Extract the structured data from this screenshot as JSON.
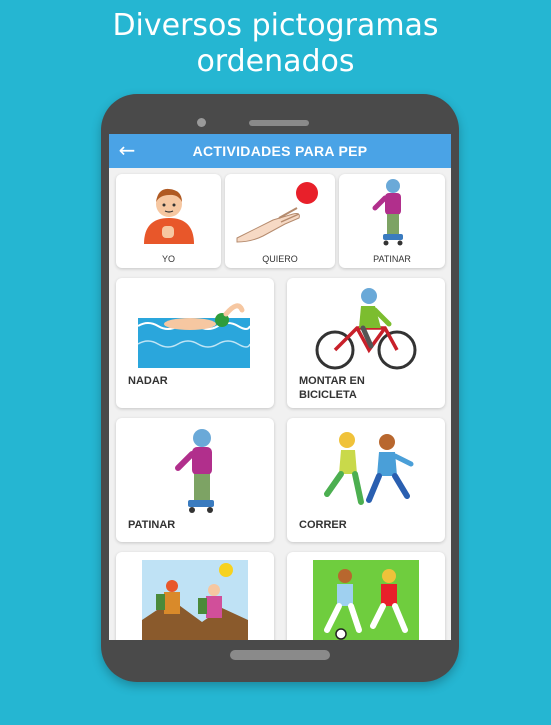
{
  "headline": {
    "line1": "Diversos pictogramas",
    "line2": "ordenados"
  },
  "appbar": {
    "title": "ACTIVIDADES PARA PEP",
    "back_icon": "arrow-left-icon"
  },
  "grid_small": [
    {
      "label": "YO",
      "icon": "boy-pointing-self-pictogram"
    },
    {
      "label": "QUIERO",
      "icon": "hand-reaching-ball-pictogram"
    },
    {
      "label": "PATINAR",
      "icon": "inline-skater-pictogram"
    }
  ],
  "grid_large": [
    {
      "label": "NADAR",
      "icon": "swimmer-pictogram"
    },
    {
      "label": "MONTAR EN BICICLETA",
      "label_line1": "MONTAR EN",
      "label_line2": "BICICLETA",
      "icon": "cyclist-pictogram"
    },
    {
      "label": "PATINAR",
      "icon": "inline-skater-pictogram"
    },
    {
      "label": "CORRER",
      "icon": "runners-pictogram"
    },
    {
      "label": "",
      "icon": "hikers-pictogram"
    },
    {
      "label": "",
      "icon": "football-players-pictogram"
    }
  ],
  "colors": {
    "background": "#25b6d2",
    "appbar": "#4aa3e6",
    "phone_body": "#4a4a4a",
    "screen": "#f1f1f1"
  }
}
